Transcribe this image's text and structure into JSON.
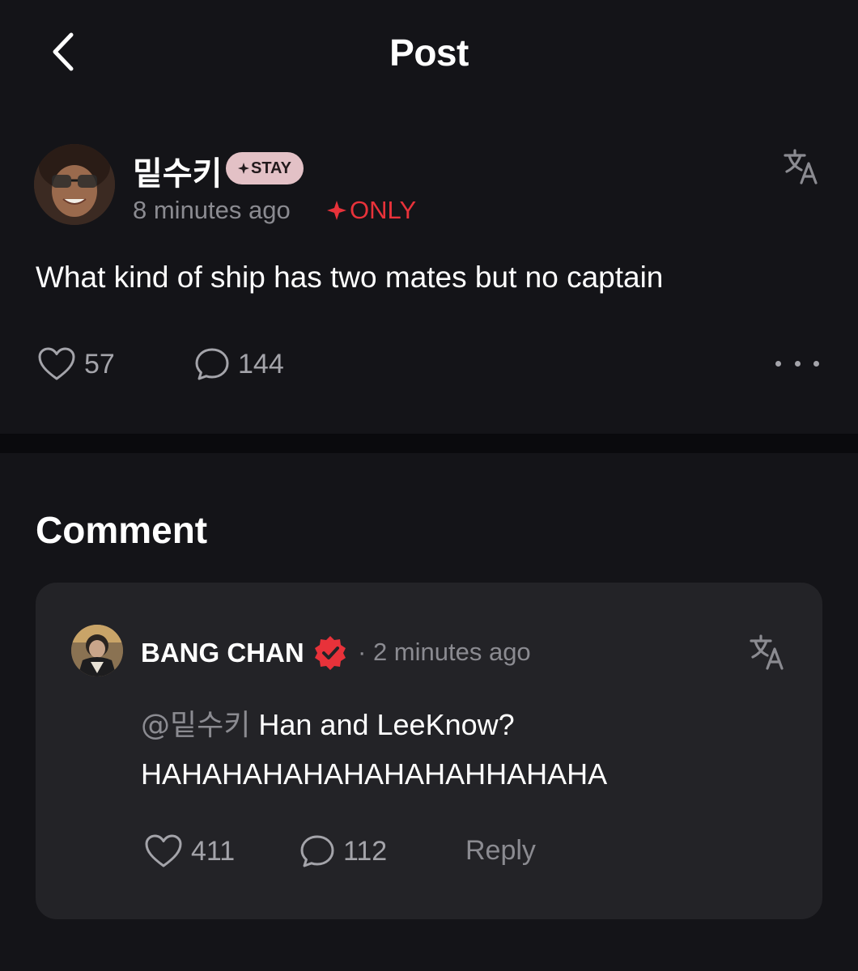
{
  "header": {
    "title": "Post"
  },
  "post": {
    "author": "밑수키",
    "badge": "STAY",
    "time": "8 minutes ago",
    "only_label": "ONLY",
    "text": "What kind of ship has two mates but no captain",
    "likes": "57",
    "comments": "144"
  },
  "comments_section": {
    "title": "Comment",
    "items": [
      {
        "author": "BANG CHAN",
        "time": "2 minutes ago",
        "mention": "@밑수키",
        "text_line1": "Han and LeeKnow?",
        "text_line2": "HAHAHAHAHAHAHAHAHHAHAHA",
        "likes": "411",
        "comments": "112",
        "reply_label": "Reply"
      }
    ]
  },
  "colors": {
    "background": "#141418",
    "card": "#232327",
    "only_red": "#e8323a",
    "badge_pink": "#e3c1c6",
    "muted_text": "#8b8b91"
  },
  "icons": [
    "back-chevron-icon",
    "translate-icon",
    "heart-icon",
    "comment-bubble-icon",
    "more-dots-icon",
    "verified-badge-icon",
    "sparkle-icon"
  ]
}
